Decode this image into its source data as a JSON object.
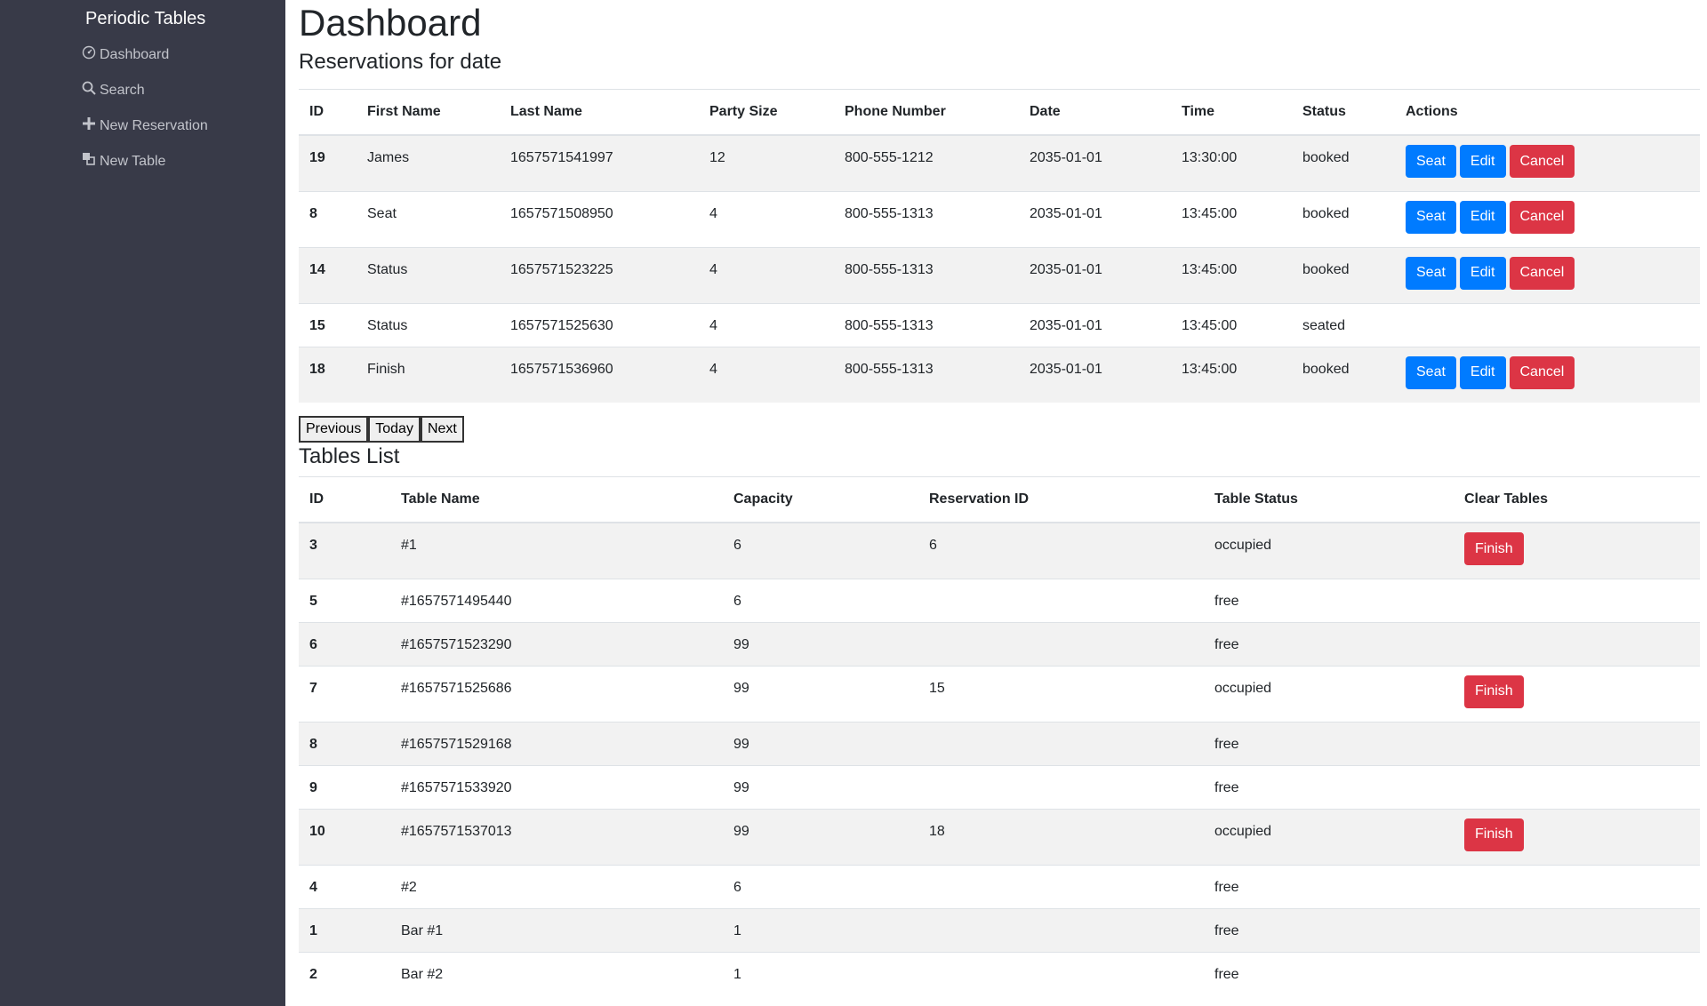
{
  "sidebar": {
    "brand": "Periodic Tables",
    "items": [
      {
        "label": "Dashboard",
        "icon": "dashboard-icon"
      },
      {
        "label": "Search",
        "icon": "search-icon"
      },
      {
        "label": "New Reservation",
        "icon": "plus-icon"
      },
      {
        "label": "New Table",
        "icon": "layers-icon"
      }
    ]
  },
  "page": {
    "title": "Dashboard",
    "reservations_heading": "Reservations for date",
    "tables_heading": "Tables List"
  },
  "reservations": {
    "columns": [
      "ID",
      "First Name",
      "Last Name",
      "Party Size",
      "Phone Number",
      "Date",
      "Time",
      "Status",
      "Actions"
    ],
    "rows": [
      {
        "id": "19",
        "first": "James",
        "last": "1657571541997",
        "party": "12",
        "phone": "800-555-1212",
        "date": "2035-01-01",
        "time": "13:30:00",
        "status": "booked"
      },
      {
        "id": "8",
        "first": "Seat",
        "last": "1657571508950",
        "party": "4",
        "phone": "800-555-1313",
        "date": "2035-01-01",
        "time": "13:45:00",
        "status": "booked"
      },
      {
        "id": "14",
        "first": "Status",
        "last": "1657571523225",
        "party": "4",
        "phone": "800-555-1313",
        "date": "2035-01-01",
        "time": "13:45:00",
        "status": "booked"
      },
      {
        "id": "15",
        "first": "Status",
        "last": "1657571525630",
        "party": "4",
        "phone": "800-555-1313",
        "date": "2035-01-01",
        "time": "13:45:00",
        "status": "seated"
      },
      {
        "id": "18",
        "first": "Finish",
        "last": "1657571536960",
        "party": "4",
        "phone": "800-555-1313",
        "date": "2035-01-01",
        "time": "13:45:00",
        "status": "booked"
      }
    ],
    "actions": {
      "seat": "Seat",
      "edit": "Edit",
      "cancel": "Cancel"
    }
  },
  "pager": {
    "previous": "Previous",
    "today": "Today",
    "next": "Next"
  },
  "tables": {
    "columns": [
      "ID",
      "Table Name",
      "Capacity",
      "Reservation ID",
      "Table Status",
      "Clear Tables"
    ],
    "rows": [
      {
        "id": "3",
        "name": "#1",
        "capacity": "6",
        "reservation_id": "6",
        "status": "occupied"
      },
      {
        "id": "5",
        "name": "#1657571495440",
        "capacity": "6",
        "reservation_id": "",
        "status": "free"
      },
      {
        "id": "6",
        "name": "#1657571523290",
        "capacity": "99",
        "reservation_id": "",
        "status": "free"
      },
      {
        "id": "7",
        "name": "#1657571525686",
        "capacity": "99",
        "reservation_id": "15",
        "status": "occupied"
      },
      {
        "id": "8",
        "name": "#1657571529168",
        "capacity": "99",
        "reservation_id": "",
        "status": "free"
      },
      {
        "id": "9",
        "name": "#1657571533920",
        "capacity": "99",
        "reservation_id": "",
        "status": "free"
      },
      {
        "id": "10",
        "name": "#1657571537013",
        "capacity": "99",
        "reservation_id": "18",
        "status": "occupied"
      },
      {
        "id": "4",
        "name": "#2",
        "capacity": "6",
        "reservation_id": "",
        "status": "free"
      },
      {
        "id": "1",
        "name": "Bar #1",
        "capacity": "1",
        "reservation_id": "",
        "status": "free"
      },
      {
        "id": "2",
        "name": "Bar #2",
        "capacity": "1",
        "reservation_id": "",
        "status": "free"
      }
    ],
    "finish_label": "Finish"
  },
  "colors": {
    "sidebar": "#383a48",
    "primary": "#007bff",
    "danger": "#dc3545",
    "stripe": "#f2f2f2"
  }
}
